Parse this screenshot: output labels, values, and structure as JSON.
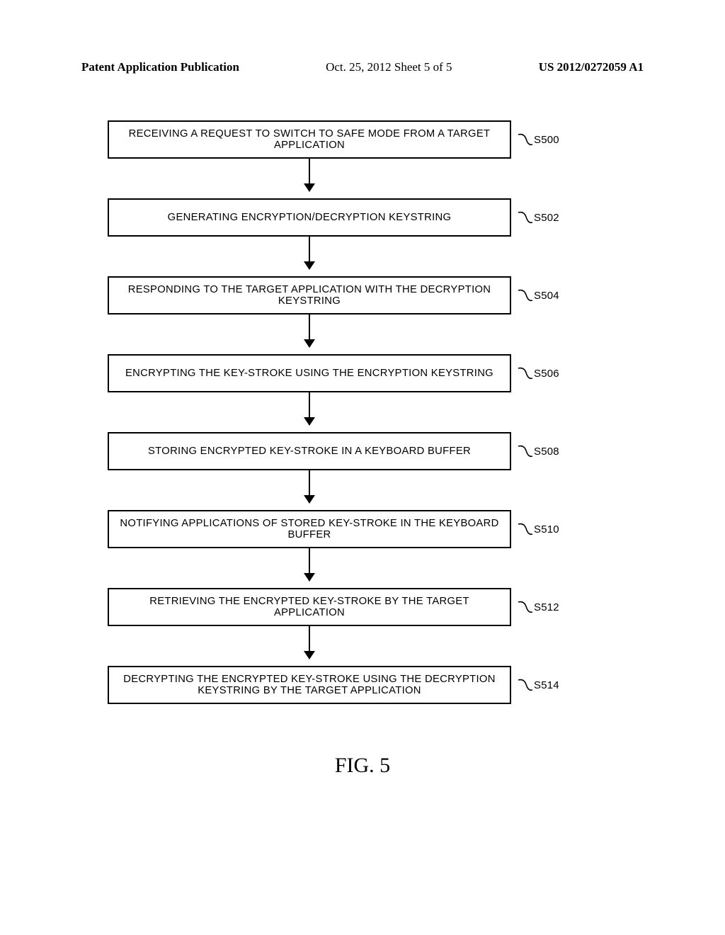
{
  "header": {
    "left": "Patent Application Publication",
    "center": "Oct. 25, 2012  Sheet 5 of 5",
    "right": "US 2012/0272059 A1"
  },
  "steps": [
    {
      "text": "RECEIVING A REQUEST TO SWITCH TO SAFE MODE FROM A TARGET APPLICATION",
      "label": "S500"
    },
    {
      "text": "GENERATING ENCRYPTION/DECRYPTION KEYSTRING",
      "label": "S502"
    },
    {
      "text": "RESPONDING TO THE TARGET APPLICATION WITH THE DECRYPTION KEYSTRING",
      "label": "S504"
    },
    {
      "text": "ENCRYPTING THE KEY-STROKE USING THE ENCRYPTION KEYSTRING",
      "label": "S506"
    },
    {
      "text": "STORING ENCRYPTED KEY-STROKE IN A KEYBOARD BUFFER",
      "label": "S508"
    },
    {
      "text": "NOTIFYING APPLICATIONS OF STORED KEY-STROKE IN THE KEYBOARD BUFFER",
      "label": "S510"
    },
    {
      "text": "RETRIEVING THE ENCRYPTED KEY-STROKE BY THE TARGET APPLICATION",
      "label": "S512"
    },
    {
      "text": "DECRYPTING THE ENCRYPTED KEY-STROKE USING THE DECRYPTION KEYSTRING BY THE TARGET APPLICATION",
      "label": "S514"
    }
  ],
  "figure_label": "FIG. 5"
}
